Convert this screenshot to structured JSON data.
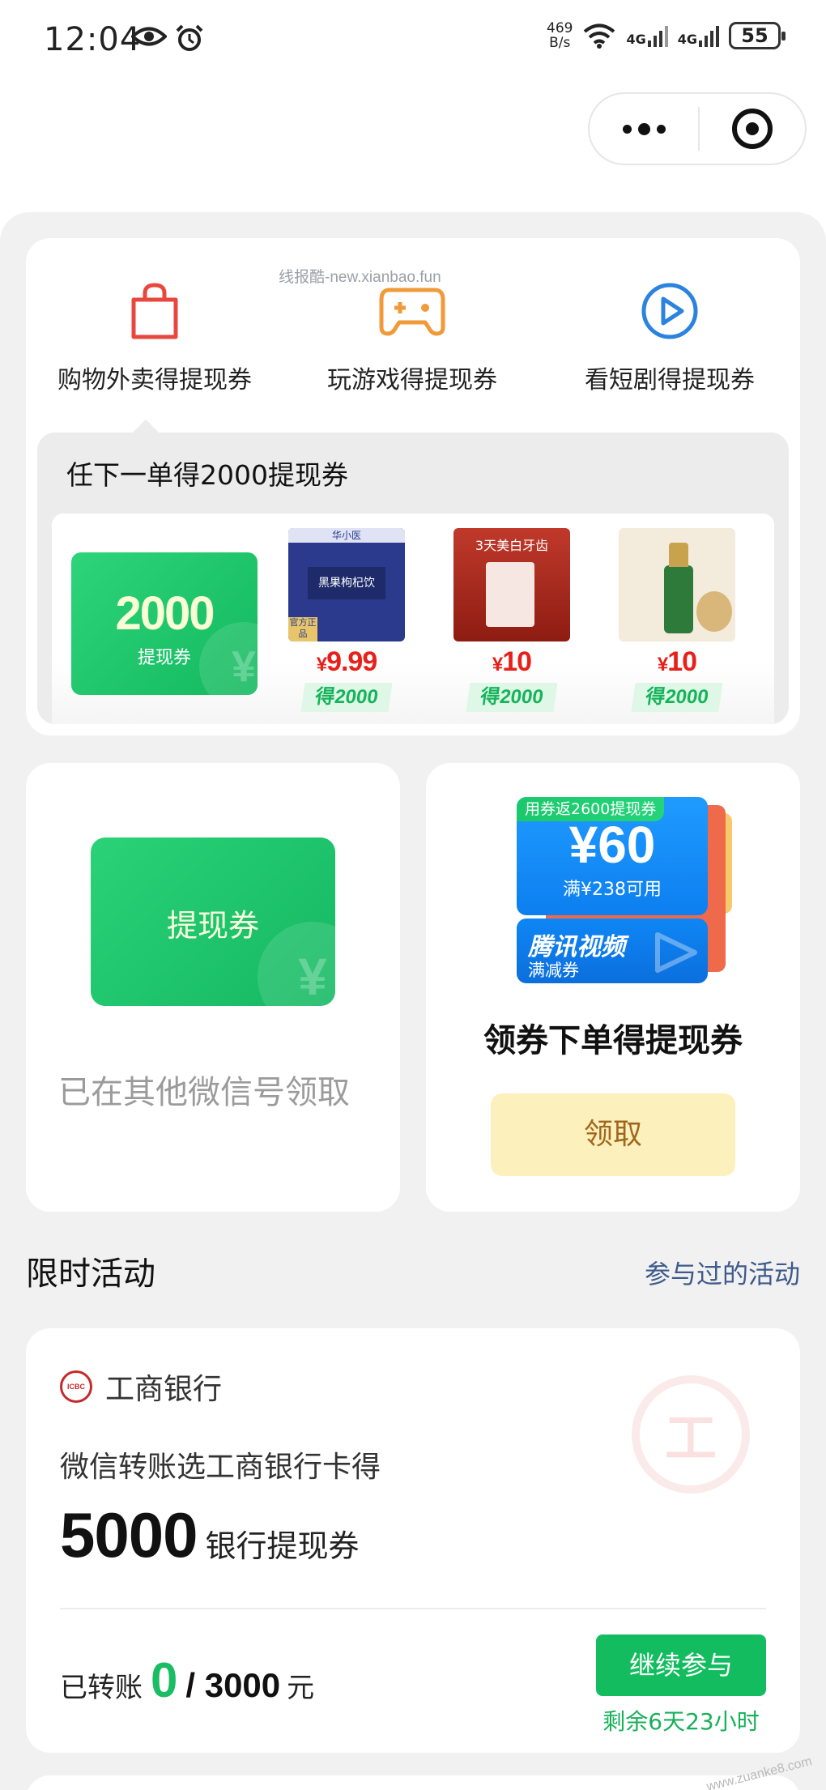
{
  "status_bar": {
    "time": "12:04",
    "net_speed_value": "469",
    "net_speed_unit": "B/s",
    "sim1": "4G",
    "sim2": "4G",
    "battery": "55"
  },
  "categories": [
    {
      "label": "购物外卖得提现券",
      "icon": "shopping-bag-icon",
      "color": "#e8473e"
    },
    {
      "label": "玩游戏得提现券",
      "icon": "gamepad-icon",
      "color": "#f09a3a"
    },
    {
      "label": "看短剧得提现券",
      "icon": "play-circle-icon",
      "color": "#2b83e0"
    }
  ],
  "promo": {
    "title": "任下一单得2000提现券",
    "watermark": "线报酷-new.xianbao.fun",
    "voucher_amount": "2000",
    "voucher_label": "提现券",
    "products": [
      {
        "currency": "¥",
        "price": "9.99",
        "earn": "得2000",
        "img_text_1": "华小医",
        "img_text_2": "官方正品",
        "img_text_3": "黑果枸杞饮",
        "img_text_4": "官方正品"
      },
      {
        "currency": "¥",
        "price": "10",
        "earn": "得2000",
        "img_text_1": "3天美白牙齿"
      },
      {
        "currency": "¥",
        "price": "10",
        "earn": "得2000"
      }
    ]
  },
  "left_card": {
    "voucher_label": "提现券",
    "status": "已在其他微信号领取"
  },
  "right_card": {
    "badge": "用券返2600提现券",
    "amount": "¥60",
    "condition": "满¥238可用",
    "brand": "腾讯视频",
    "brand_sub": "满减券",
    "title": "领券下单得提现券",
    "button": "领取"
  },
  "section": {
    "title": "限时活动",
    "link": "参与过的活动"
  },
  "bank_card": {
    "bank_name": "工商银行",
    "logo_text": "ICBC",
    "watermark_glyph": "工",
    "description": "微信转账选工商银行卡得",
    "amount": "5000",
    "amount_label": "银行提现券",
    "progress_label": "已转账",
    "progress_current": "0",
    "progress_total": "/ 3000",
    "progress_unit": "元",
    "button": "继续参与",
    "remaining": "剩余6天23小时"
  },
  "corner_watermark": "www.zuanke8.com"
}
